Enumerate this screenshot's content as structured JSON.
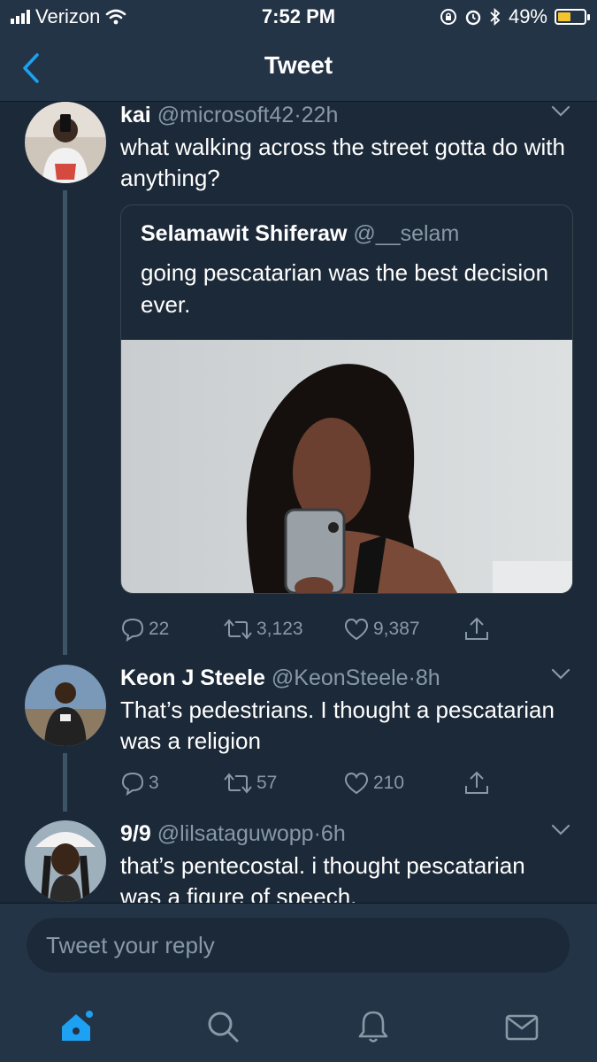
{
  "status_bar": {
    "carrier": "Verizon",
    "time": "7:52 PM",
    "battery": "49%",
    "battery_level": 0.49
  },
  "nav": {
    "title": "Tweet"
  },
  "tweets": [
    {
      "name": "kai",
      "handle": "@microsoft42",
      "time": "22h",
      "text": "what walking across the street gotta do with anything?",
      "quote": {
        "name": "Selamawit Shiferaw",
        "handle": "@__selam",
        "text": "going pescatarian was the best decision ever."
      },
      "stats": {
        "replies": "22",
        "retweets": "3,123",
        "likes": "9,387"
      }
    },
    {
      "name": "Keon J Steele",
      "handle": "@KeonSteele",
      "time": "8h",
      "text": "That’s pedestrians. I thought a pescatarian was a religion",
      "stats": {
        "replies": "3",
        "retweets": "57",
        "likes": "210"
      }
    },
    {
      "name": "9/9",
      "handle": "@lilsataguwopp",
      "time": "6h",
      "text": "that’s pentecostal. i thought pescatarian was a figure of speech."
    }
  ],
  "reply": {
    "placeholder": "Tweet your reply"
  },
  "tabs": [
    "home-icon",
    "search-icon",
    "notifications-icon",
    "messages-icon"
  ],
  "colors": {
    "background": "#1c2938",
    "bars": "#243447",
    "accent": "#1da1f2",
    "muted": "#8899a6"
  }
}
